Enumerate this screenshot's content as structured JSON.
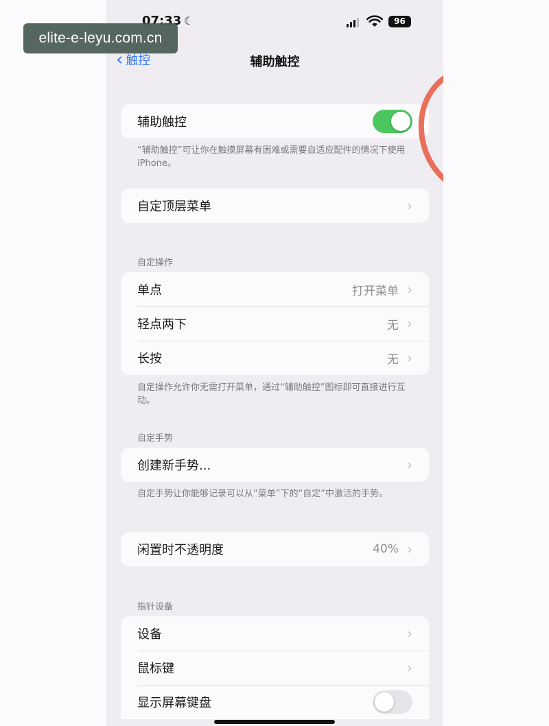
{
  "watermark": "elite-e-leyu.com.cn",
  "status_bar": {
    "time": "07:33",
    "battery": "96"
  },
  "nav": {
    "back_label": "触控",
    "title": "辅助触控"
  },
  "assistive_touch": {
    "label": "辅助触控",
    "enabled": true,
    "footnote": "“辅助触控”可让你在触摸屏幕有困难或需要自适应配件的情况下使用iPhone。"
  },
  "top_menu": {
    "label": "自定顶层菜单"
  },
  "custom_actions": {
    "header": "自定操作",
    "rows": [
      {
        "label": "单点",
        "value": "打开菜单"
      },
      {
        "label": "轻点两下",
        "value": "无"
      },
      {
        "label": "长按",
        "value": "无"
      }
    ],
    "footnote": "自定操作允许你无需打开菜单，通过“辅助触控”图标即可直接进行互动。"
  },
  "custom_gestures": {
    "header": "自定手势",
    "create_label": "创建新手势...",
    "footnote": "自定手势让你能够记录可以从“菜单”下的“自定”中激活的手势。"
  },
  "idle_opacity": {
    "label": "闲置时不透明度",
    "value": "40%"
  },
  "pointer_devices": {
    "header": "指针设备",
    "rows": [
      {
        "label": "设备"
      },
      {
        "label": "鼠标键"
      }
    ],
    "keyboard_label": "显示屏幕键盘",
    "keyboard_enabled": false
  },
  "colors": {
    "accent": "#3478f6",
    "toggle_on": "#4cc75f",
    "annotation": "#e8604a"
  }
}
